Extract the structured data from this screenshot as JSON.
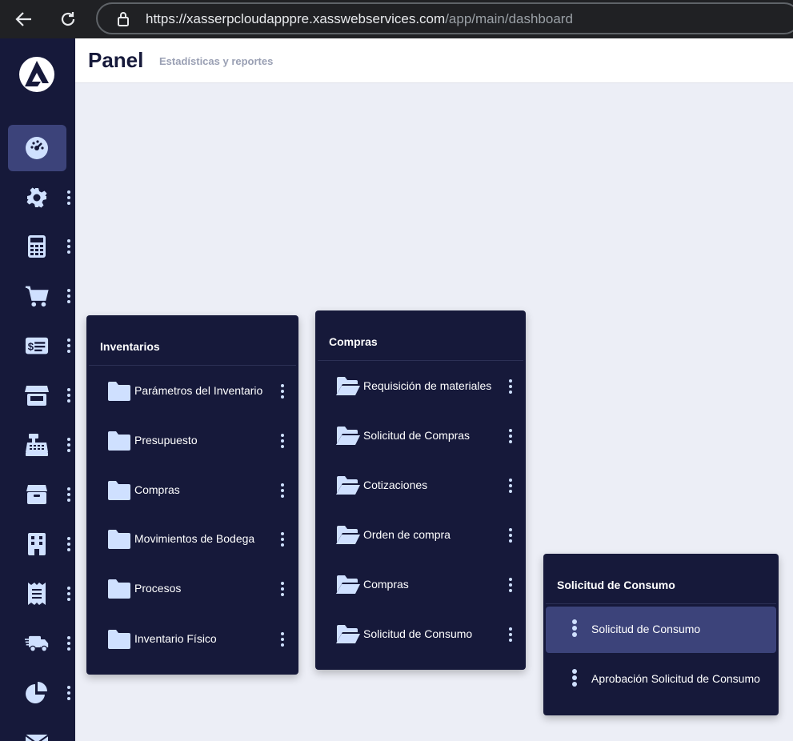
{
  "browser": {
    "url_host": "https://xasserpcloudapppre.xasswebservices.com",
    "url_path": "/app/main/dashboard"
  },
  "header": {
    "title": "Panel",
    "subtitle": "Estadísticas y reportes"
  },
  "sidebar": {
    "items": [
      {
        "icon": "dashboard-gauge-icon",
        "active": true
      },
      {
        "icon": "gear-icon"
      },
      {
        "icon": "calculator-icon"
      },
      {
        "icon": "cart-icon"
      },
      {
        "icon": "money-bill-icon"
      },
      {
        "icon": "store-icon"
      },
      {
        "icon": "cash-register-icon"
      },
      {
        "icon": "box-icon"
      },
      {
        "icon": "building-icon"
      },
      {
        "icon": "receipt-icon"
      },
      {
        "icon": "truck-icon"
      },
      {
        "icon": "pie-chart-icon"
      },
      {
        "icon": "envelope-icon"
      }
    ]
  },
  "panels": {
    "inventarios": {
      "title": "Inventarios",
      "items": [
        {
          "label": "Parámetros del Inventario"
        },
        {
          "label": "Presupuesto"
        },
        {
          "label": "Compras"
        },
        {
          "label": "Movimientos de Bodega"
        },
        {
          "label": "Procesos"
        },
        {
          "label": "Inventario Físico"
        }
      ]
    },
    "compras": {
      "title": "Compras",
      "items": [
        {
          "label": "Requisición de materiales"
        },
        {
          "label": "Solicitud de Compras"
        },
        {
          "label": "Cotizaciones"
        },
        {
          "label": "Orden de compra"
        },
        {
          "label": "Compras"
        },
        {
          "label": "Solicitud de Consumo"
        }
      ]
    },
    "solicitud": {
      "title": "Solicitud de Consumo",
      "items": [
        {
          "label": "Solicitud de Consumo",
          "active": true
        },
        {
          "label": "Aprobación Solicitud de Consumo"
        }
      ]
    }
  },
  "colors": {
    "sidebar": "#16193a",
    "active": "#3c437a",
    "icon": "#cfe0ff",
    "background": "#eceef6"
  }
}
